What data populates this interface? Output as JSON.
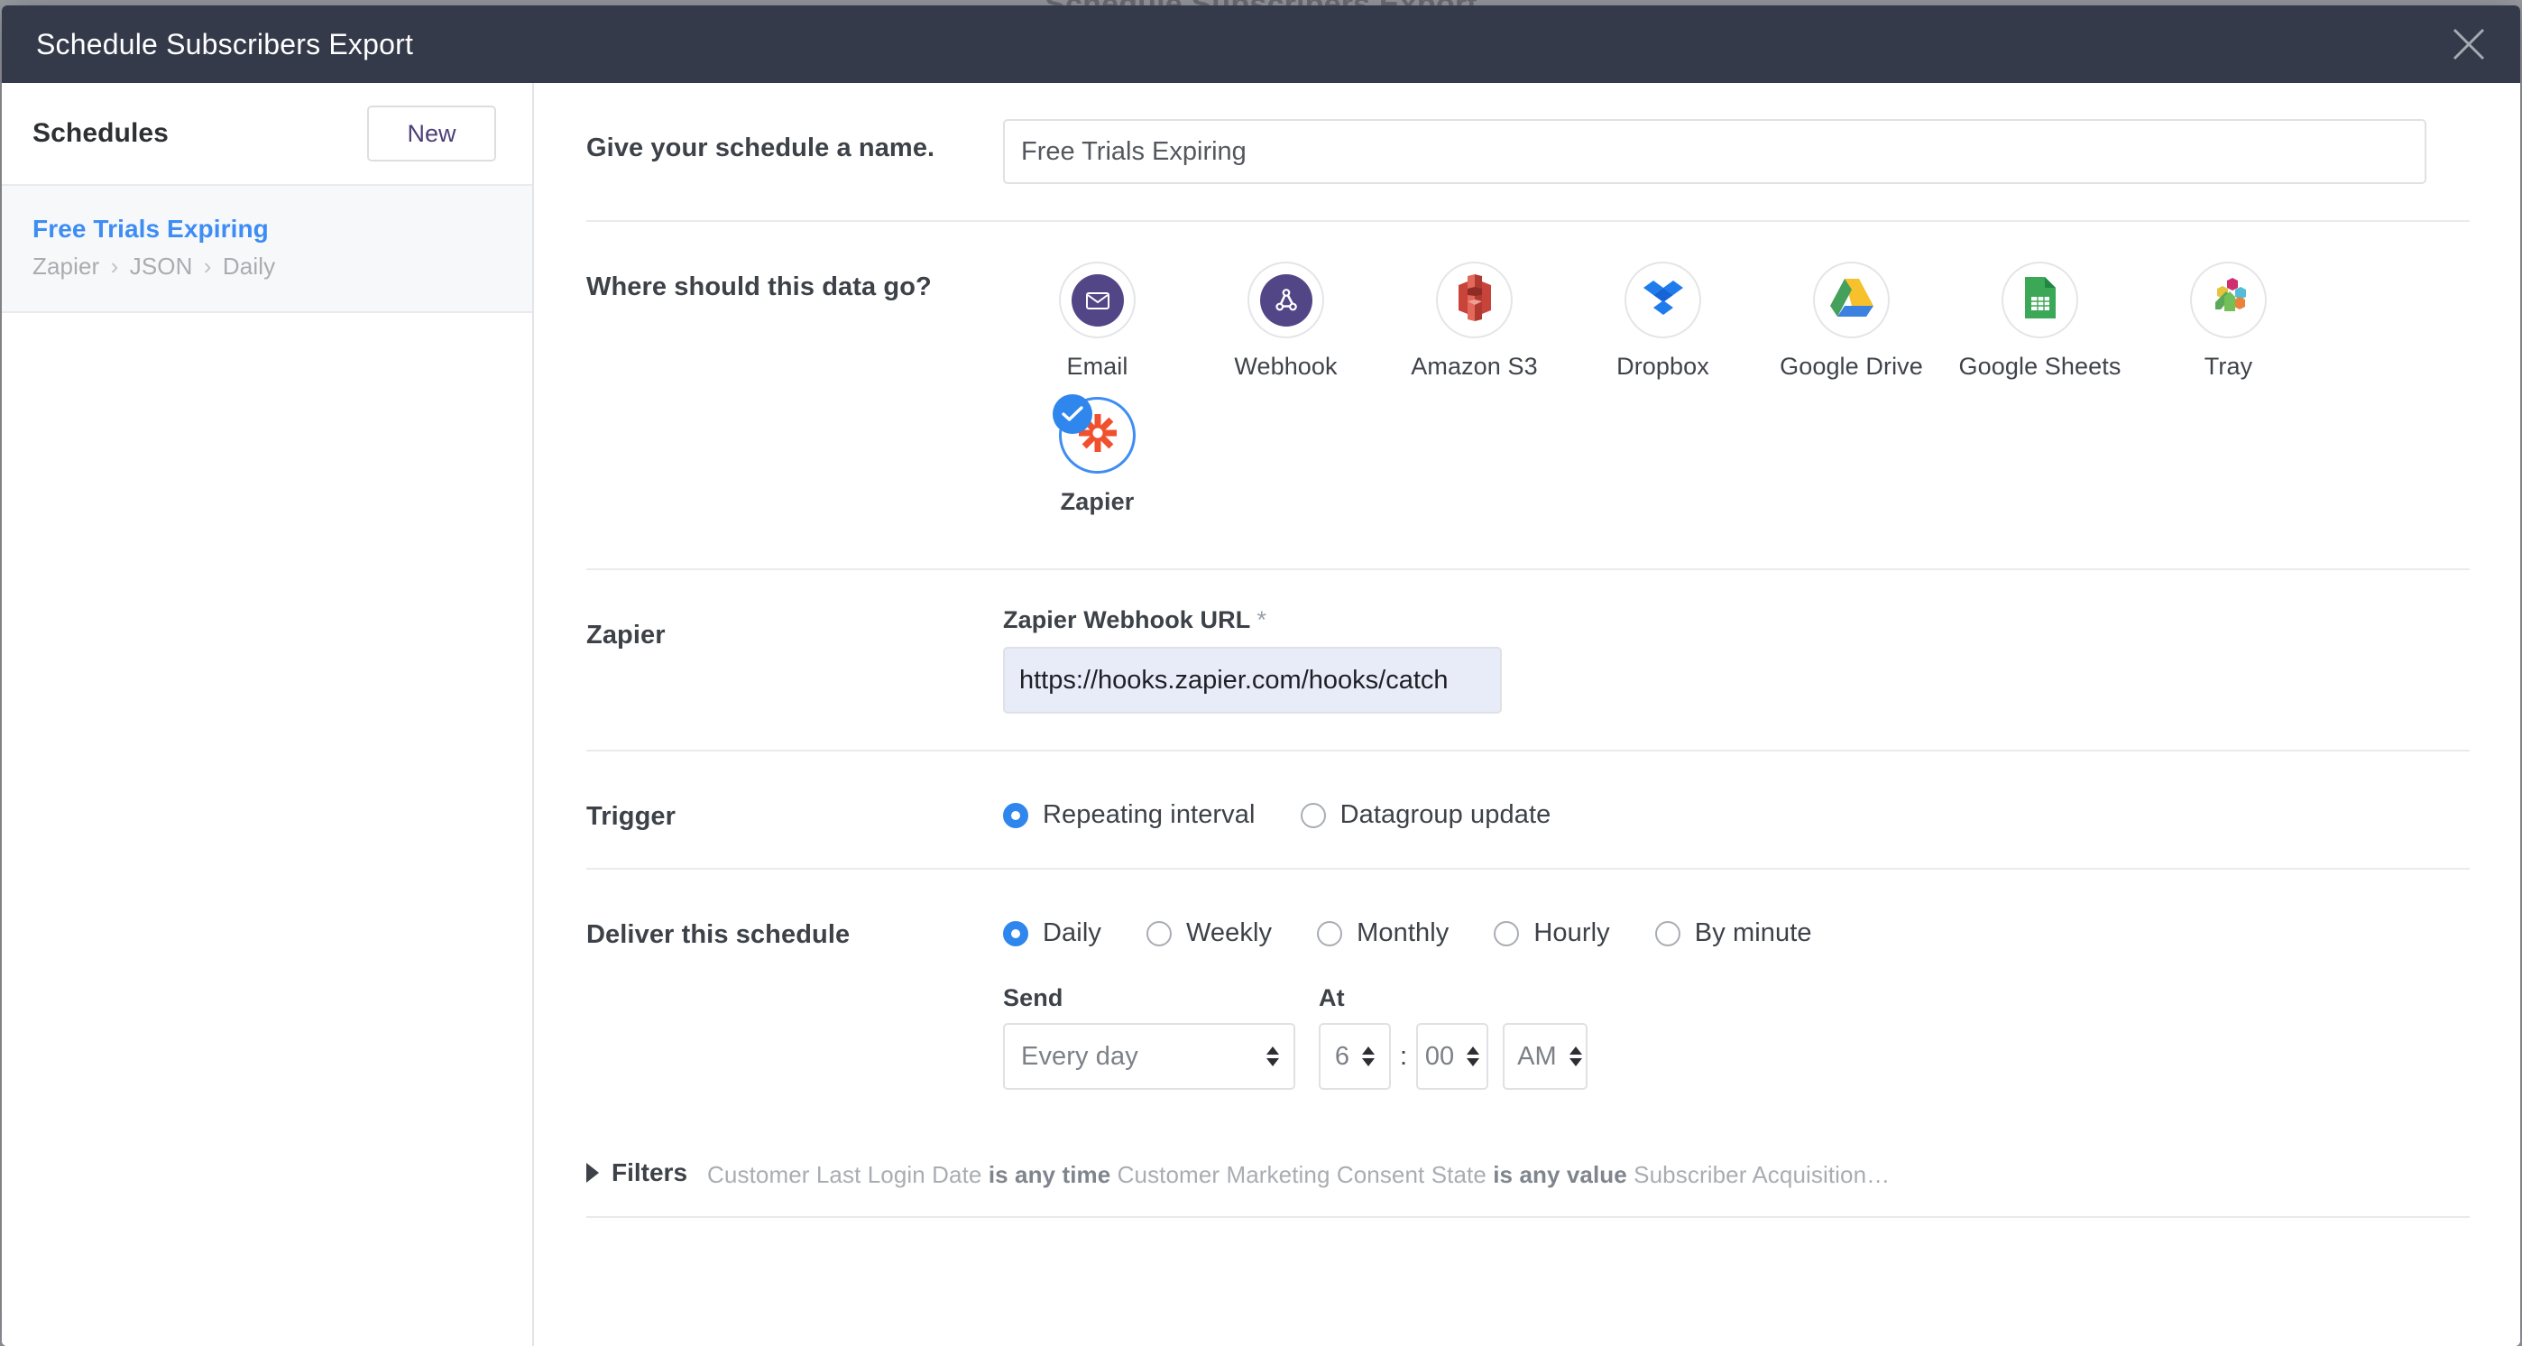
{
  "backdrop": {
    "title": "Schedule Subscribers Export"
  },
  "modal": {
    "title": "Schedule Subscribers Export",
    "close_icon": "close-icon"
  },
  "sidebar": {
    "heading": "Schedules",
    "new_button": "New",
    "schedules": [
      {
        "name": "Free Trials Expiring",
        "destination": "Zapier",
        "format": "JSON",
        "cadence": "Daily",
        "separator": "›",
        "selected": true
      }
    ]
  },
  "form": {
    "name_row": {
      "label": "Give your schedule a name.",
      "value": "Free Trials Expiring",
      "placeholder": "Give your schedule a name."
    },
    "destination_row": {
      "label": "Where should this data go?",
      "options": [
        {
          "label": "Email",
          "icon": "email-icon",
          "selected": false
        },
        {
          "label": "Webhook",
          "icon": "webhook-icon",
          "selected": false
        },
        {
          "label": "Amazon S3",
          "icon": "amazon-s3-icon",
          "selected": false
        },
        {
          "label": "Dropbox",
          "icon": "dropbox-icon",
          "selected": false
        },
        {
          "label": "Google Drive",
          "icon": "google-drive-icon",
          "selected": false
        },
        {
          "label": "Google Sheets",
          "icon": "google-sheets-icon",
          "selected": false
        },
        {
          "label": "Tray",
          "icon": "tray-icon",
          "selected": false
        },
        {
          "label": "Zapier",
          "icon": "zapier-icon",
          "selected": true
        }
      ]
    },
    "zapier_row": {
      "label": "Zapier",
      "url_label": "Zapier Webhook URL",
      "required_marker": "*",
      "url_value": "https://hooks.zapier.com/hooks/catch",
      "url_placeholder": "https://hooks.zapier.com/hooks/catch/"
    },
    "trigger_row": {
      "label": "Trigger",
      "options": [
        {
          "label": "Repeating interval",
          "checked": true
        },
        {
          "label": "Datagroup update",
          "checked": false
        }
      ]
    },
    "deliver_row": {
      "label": "Deliver this schedule",
      "options": [
        {
          "label": "Daily",
          "checked": true
        },
        {
          "label": "Weekly",
          "checked": false
        },
        {
          "label": "Monthly",
          "checked": false
        },
        {
          "label": "Hourly",
          "checked": false
        },
        {
          "label": "By minute",
          "checked": false
        }
      ],
      "send_label": "Send",
      "send_value": "Every day",
      "at_label": "At",
      "hour_value": "6",
      "time_separator": ":",
      "minute_value": "00",
      "meridiem_value": "AM"
    },
    "filters_row": {
      "label": "Filters",
      "expanded": false,
      "summary_parts": [
        {
          "text": "Customer Last Login Date ",
          "strong": false
        },
        {
          "text": "is any time",
          "strong": true
        },
        {
          "text": " Customer Marketing Consent State ",
          "strong": false
        },
        {
          "text": "is any value",
          "strong": true
        },
        {
          "text": " Subscriber Acquisition…",
          "strong": false
        }
      ]
    }
  },
  "colors": {
    "header_bg": "#343a4a",
    "accent_blue": "#3d8df5",
    "check_blue": "#2f86ec",
    "purple_badge": "#534687",
    "link_blue": "#3d8df5",
    "new_button_text": "#4c3f78",
    "url_field_bg": "#e8ecf9",
    "muted_text": "#a9adb3"
  }
}
